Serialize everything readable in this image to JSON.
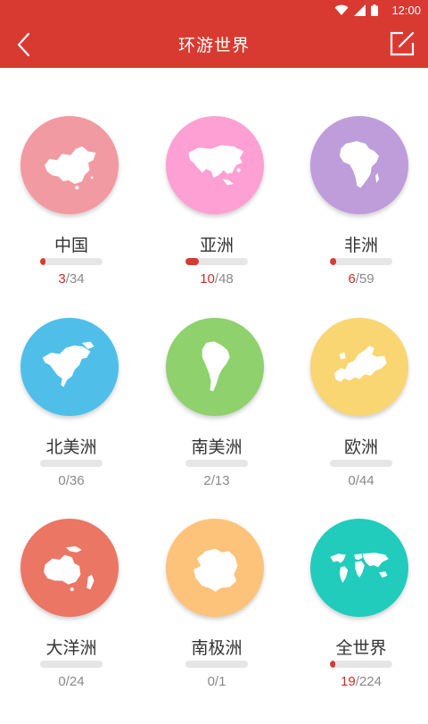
{
  "status": {
    "time": "12:00"
  },
  "header": {
    "title": "环游世界"
  },
  "items": [
    {
      "label": "中国",
      "done": "3",
      "sep_total": "/34",
      "progress": 0.09,
      "color": "#f29aa1",
      "icon": "china-map-icon"
    },
    {
      "label": "亚洲",
      "done": "10",
      "sep_total": "/48",
      "progress": 0.21,
      "color": "#fea0d4",
      "icon": "asia-map-icon"
    },
    {
      "label": "非洲",
      "done": "6",
      "sep_total": "/59",
      "progress": 0.1,
      "color": "#bf9cda",
      "icon": "africa-map-icon"
    },
    {
      "label": "北美洲",
      "done": "0",
      "sep_total": "/36",
      "progress": 0,
      "color": "#4fbfea",
      "icon": "north-america-map-icon"
    },
    {
      "label": "南美洲",
      "done": "2",
      "sep_total": "/13",
      "progress": 0,
      "color": "#8fd16d",
      "icon": "south-america-map-icon"
    },
    {
      "label": "欧洲",
      "done": "0",
      "sep_total": "/44",
      "progress": 0,
      "color": "#f9d672",
      "icon": "europe-map-icon"
    },
    {
      "label": "大洋洲",
      "done": "0",
      "sep_total": "/24",
      "progress": 0,
      "color": "#ea7663",
      "icon": "oceania-map-icon"
    },
    {
      "label": "南极洲",
      "done": "0",
      "sep_total": "/1",
      "progress": 0,
      "color": "#fdc37a",
      "icon": "antarctica-map-icon"
    },
    {
      "label": "全世界",
      "done": "19",
      "sep_total": "/224",
      "progress": 0.08,
      "color": "#21ccbc",
      "icon": "world-map-icon"
    }
  ]
}
